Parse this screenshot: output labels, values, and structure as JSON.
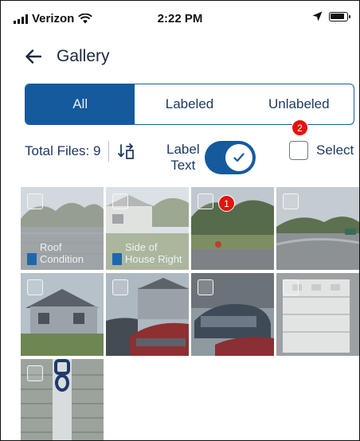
{
  "status_bar": {
    "carrier": "Verizon",
    "time": "2:22 PM"
  },
  "header": {
    "title": "Gallery",
    "back_icon": "arrow-left-icon"
  },
  "tabs": [
    {
      "label": "All",
      "active": true
    },
    {
      "label": "Labeled",
      "active": false
    },
    {
      "label": "Unlabeled",
      "active": false
    }
  ],
  "toolbar": {
    "total_files": "Total Files: 9",
    "toggle_label_line1": "Label",
    "toggle_label_line2": "Text",
    "toggle_on": true,
    "select_label": "Select"
  },
  "annotations": {
    "badge_select": "2",
    "badge_tile": "1"
  },
  "colors": {
    "accent": "#145a9c",
    "badge": "#e3130f"
  },
  "gallery": [
    {
      "label": "Roof Condition"
    },
    {
      "label": "Side of House Right"
    },
    {
      "label": ""
    },
    {
      "label": ""
    },
    {
      "label": ""
    },
    {
      "label": ""
    },
    {
      "label": ""
    },
    {
      "label": ""
    },
    {
      "label": ""
    }
  ]
}
